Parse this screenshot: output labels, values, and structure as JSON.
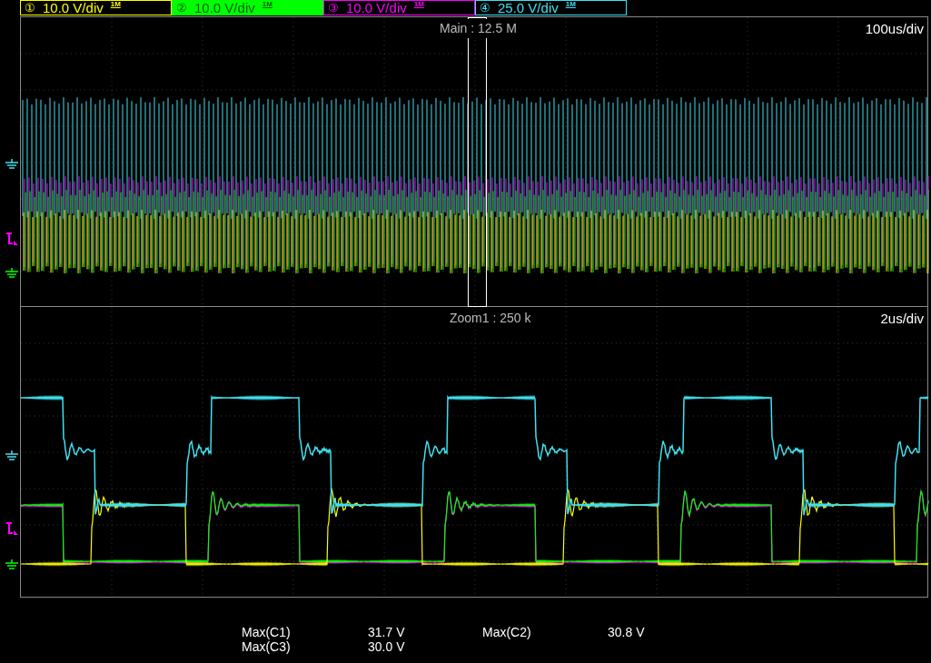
{
  "channels": [
    {
      "number": "①",
      "scale": "10.0 V/div",
      "impedance": "1M",
      "color": "#ffff00",
      "selected": false
    },
    {
      "number": "②",
      "scale": "10.0 V/div",
      "impedance": "1M",
      "color": "#00ff00",
      "selected": true
    },
    {
      "number": "③",
      "scale": "10.0 V/div",
      "impedance": "1M",
      "color": "#ff00ff",
      "selected": false
    },
    {
      "number": "④",
      "scale": "25.0 V/div",
      "impedance": "1M",
      "color": "#40e0f0",
      "selected": false
    }
  ],
  "main": {
    "record": "Main : 12.5 M",
    "timebase": "100us/div"
  },
  "zoom": {
    "record": "Zoom1 : 250 k",
    "timebase": "2us/div"
  },
  "measurements": [
    {
      "name": "Max(C1)",
      "value": "31.7 V"
    },
    {
      "name": "Max(C2)",
      "value": "30.8 V"
    },
    {
      "name": "Max(C3)",
      "value": "30.0 V"
    }
  ]
}
